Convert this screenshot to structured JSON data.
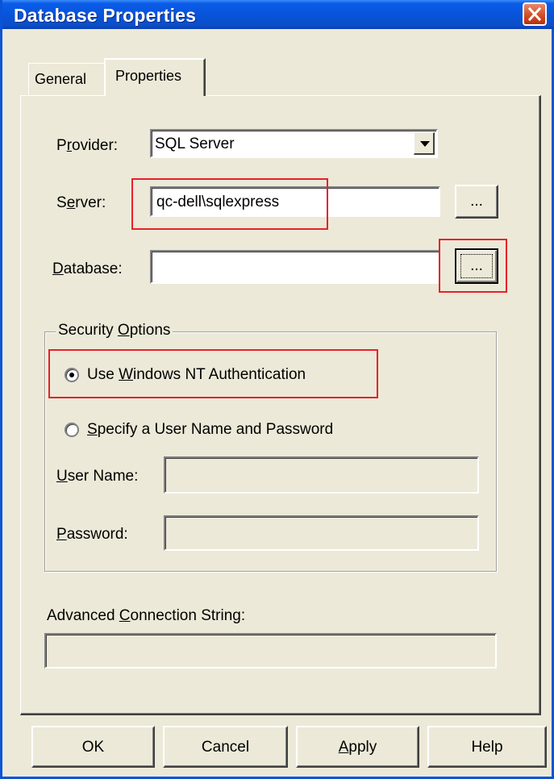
{
  "window": {
    "title": "Database Properties",
    "close_icon": "close-icon"
  },
  "tabs": [
    {
      "label": "General",
      "active": false
    },
    {
      "label": "Properties",
      "active": true
    }
  ],
  "form": {
    "provider": {
      "label_prefix": "P",
      "label_access": "r",
      "label_rest": "ovider:",
      "value": "SQL Server",
      "dropdown_icon": "chevron-down-icon"
    },
    "server": {
      "label_prefix": "S",
      "label_access": "e",
      "label_rest": "rver:",
      "value": "qc-dell\\sqlexpress",
      "browse_label": "..."
    },
    "database": {
      "label_access": "D",
      "label_rest": "atabase:",
      "value": "",
      "browse_label": "..."
    }
  },
  "security": {
    "group_prefix": "Security ",
    "group_access": "O",
    "group_rest": "ptions",
    "option_nt": {
      "prefix": "Use ",
      "access": "W",
      "rest": "indows NT Authentication",
      "selected": true
    },
    "option_user": {
      "access": "S",
      "rest": "pecify a User Name and Password",
      "selected": false
    },
    "username": {
      "access": "U",
      "rest": "ser Name:",
      "value": ""
    },
    "password": {
      "access": "P",
      "rest": "assword:",
      "value": ""
    }
  },
  "advanced": {
    "prefix": "Advanced ",
    "access": "C",
    "rest": "onnection String:",
    "value": ""
  },
  "buttons": {
    "ok": "OK",
    "cancel": "Cancel",
    "apply_access": "A",
    "apply_rest": "pply",
    "help": "Help"
  },
  "colors": {
    "highlight": "#e8202a",
    "titlebar": "#0853d8",
    "face": "#ece9d8"
  }
}
